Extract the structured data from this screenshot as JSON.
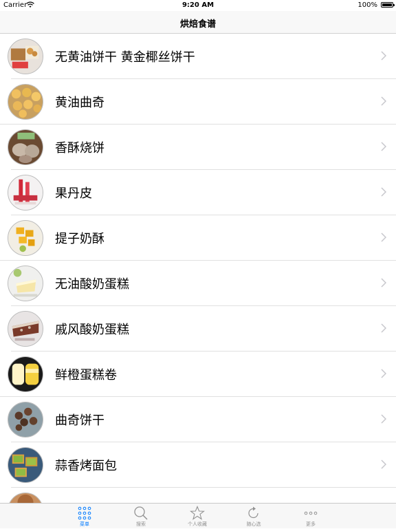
{
  "status_bar": {
    "carrier": "Carrier",
    "time": "9:20 AM",
    "battery": "100%"
  },
  "nav": {
    "title": "烘焙食谱"
  },
  "recipes": [
    {
      "name": "无黄油饼干 黄金椰丝饼干"
    },
    {
      "name": "黄油曲奇"
    },
    {
      "name": "香酥烧饼"
    },
    {
      "name": "果丹皮"
    },
    {
      "name": "提子奶酥"
    },
    {
      "name": "无油酸奶蛋糕"
    },
    {
      "name": "戚风酸奶蛋糕"
    },
    {
      "name": "鲜橙蛋糕卷"
    },
    {
      "name": "曲奇饼干"
    },
    {
      "name": "蒜香烤面包"
    }
  ],
  "tabs": [
    {
      "label": "菜单",
      "icon": "grid-icon",
      "active": true
    },
    {
      "label": "搜索",
      "icon": "search-icon",
      "active": false
    },
    {
      "label": "个人收藏",
      "icon": "star-icon",
      "active": false
    },
    {
      "label": "随心选",
      "icon": "refresh-icon",
      "active": false
    },
    {
      "label": "更多",
      "icon": "more-icon",
      "active": false
    }
  ],
  "colors": {
    "accent": "#007aff",
    "inactive": "#929292",
    "separator": "#e0e0e0"
  }
}
